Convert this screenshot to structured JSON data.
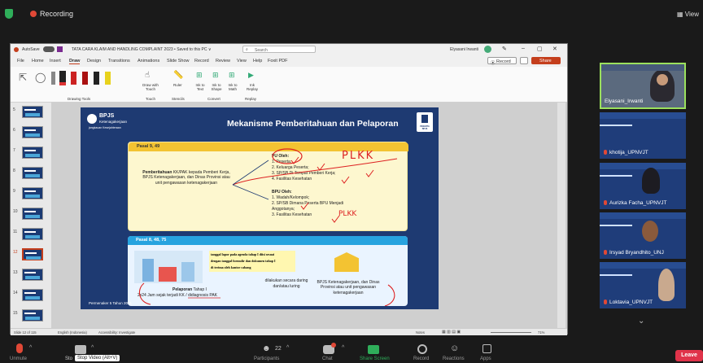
{
  "zoom": {
    "recording": "Recording",
    "view": "View",
    "bottom": {
      "unmute": "Unmute",
      "stop_video": "Stop Video (Alt+V)",
      "stop_short": "Sto",
      "participants": "Participants",
      "participants_count": "22",
      "chat": "Chat",
      "share_screen": "Share Screen",
      "record": "Record",
      "reactions": "Reactions",
      "apps": "Apps",
      "leave": "Leave"
    }
  },
  "ppt": {
    "title": "TATA CARA KLAIM AND HANDLING COMPLAINT 2023 • Saved to this PC ∨",
    "autosave": "AutoSave",
    "search": "Search",
    "user": "Elyasani Irwanti",
    "tabs": [
      "File",
      "Home",
      "Insert",
      "Draw",
      "Design",
      "Transitions",
      "Animations",
      "Slide Show",
      "Record",
      "Review",
      "View",
      "Help",
      "Foxit PDF"
    ],
    "record_btn": "Record",
    "share_btn": "Share",
    "ribbon": {
      "draw_with_touch": "Draw with Touch",
      "ruler": "Ruler",
      "ink_to_text": "Ink to Text",
      "ink_to_shape": "Ink to Shape",
      "ink_to_math": "Ink to Math",
      "ink_replay": "Ink Replay",
      "group_drawing_tools": "Drawing Tools",
      "group_touch": "Touch",
      "group_stencils": "Stencils",
      "group_convert": "Convert",
      "group_replay": "Replay"
    },
    "status": {
      "slide": "Slide 12 of 115",
      "lang": "English (Indonesia)",
      "access": "Accessibility: Investigate",
      "notes": "Notes",
      "zoom": "71%"
    },
    "slide_numbers": [
      "5",
      "6",
      "7",
      "8",
      "9",
      "10",
      "11",
      "12",
      "13",
      "14",
      "15"
    ]
  },
  "slide": {
    "logo": "BPJS",
    "logo_sub": "Ketenagakerjaan",
    "logo_tag": "jangkauan Kesejahteraan",
    "title": "Mekanisme Pemberitahuan dan Pelaporan",
    "top_tag": "PESERTA BPJS",
    "box1": {
      "header": "Pasal 9, 49",
      "left_bold": "Pemberitahuan",
      "left": "KK/PAK kepada Pemberi Kerja, BPJS Ketenagakerjaan, dan Dinas Provinsi atau unit pengawasan ketenagakerjaan",
      "pu_title": "PU Oleh:",
      "pu_items": [
        "1.  Peserta;",
        "2.  Keluarga Peserta;",
        "3.  SP/SB Di Tempat Pemberi Kerja;",
        "4.  Fasilitas Kesehatan"
      ],
      "bpu_title": "BPU Oleh:",
      "bpu_items": [
        "1.  Wadah/Kelompok;",
        "2.  SP/SB Dimana Peserta BPU Menjadi",
        "     Anggotanya;",
        "3.  Fasilitas Kesehatan"
      ],
      "ink1": "PLKK",
      "ink2": "PLKK"
    },
    "box2": {
      "header": "Pasal 8, 48, 75",
      "note1": "tanggal lapor pada agenda tahap I diisi sesuai",
      "note2": "dengan tanggal formulir dan dokumen tahap I",
      "note3": "di terima oleh kantor cabang",
      "pel_bold": "Pelaporan",
      "pel_rest": "Tahap I",
      "pel_line2": "2x24 Jam sejak terjadi KK / didiagnosis PAK",
      "mid1": "dilakukan secara daring",
      "mid2": "dan/atau luring",
      "right": "BPJS Ketenagakerjaan, dan Dinas Provinsi atau unit pengawasan ketenagakerjaan"
    },
    "footer": "Permenaker 5 Tahun 2021"
  },
  "participants": [
    {
      "name": "Elyasani_Irwanti"
    },
    {
      "name": "khotija_UPNVJT"
    },
    {
      "name": "Aurizka Facha_UPNVJT"
    },
    {
      "name": "Irsyad Bryandhito_UNJ"
    },
    {
      "name": "Loktavia_UPNVJT"
    }
  ],
  "colors": {
    "accent": "#f3c332",
    "brand": "#1e3a72",
    "leave": "#e0334a"
  }
}
